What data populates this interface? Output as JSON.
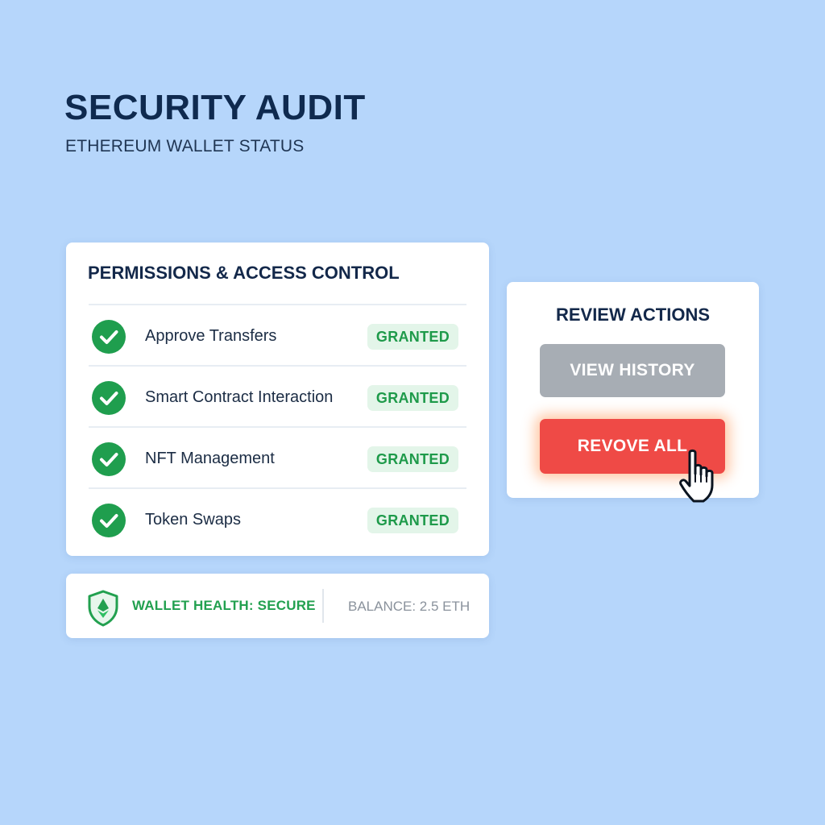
{
  "header": {
    "title": "SECURITY AUDIT",
    "subtitle": "ETHEREUM WALLET STATUS"
  },
  "permissions": {
    "heading": "PERMISSIONS & ACCESS CONTROL",
    "items": [
      {
        "label": "Approve Transfers",
        "status": "GRANTED",
        "icon": "check-circle-icon"
      },
      {
        "label": "Smart Contract Interaction",
        "status": "GRANTED",
        "icon": "check-circle-icon"
      },
      {
        "label": "NFT Management",
        "status": "GRANTED",
        "icon": "check-circle-icon"
      },
      {
        "label": "Token Swaps",
        "status": "GRANTED",
        "icon": "check-circle-icon"
      }
    ]
  },
  "health": {
    "icon": "shield-icon",
    "status_label": "WALLET HEALTH: SECURE",
    "balance_label": "BALANCE: 2.5 ETH"
  },
  "actions": {
    "heading": "REVIEW ACTIONS",
    "view_history_label": "VIEW HISTORY",
    "revoke_all_label": "REVOVE ALL"
  },
  "cursor": {
    "icon": "pointer-hand-icon"
  },
  "colors": {
    "background": "#b6d6fb",
    "title": "#0f2a4f",
    "granted_green": "#1f9e4e",
    "granted_badge_bg": "#e3f5e9",
    "revoke_red": "#ef4a46",
    "history_gray": "#a7adb4",
    "balance_gray": "#8a929c"
  }
}
